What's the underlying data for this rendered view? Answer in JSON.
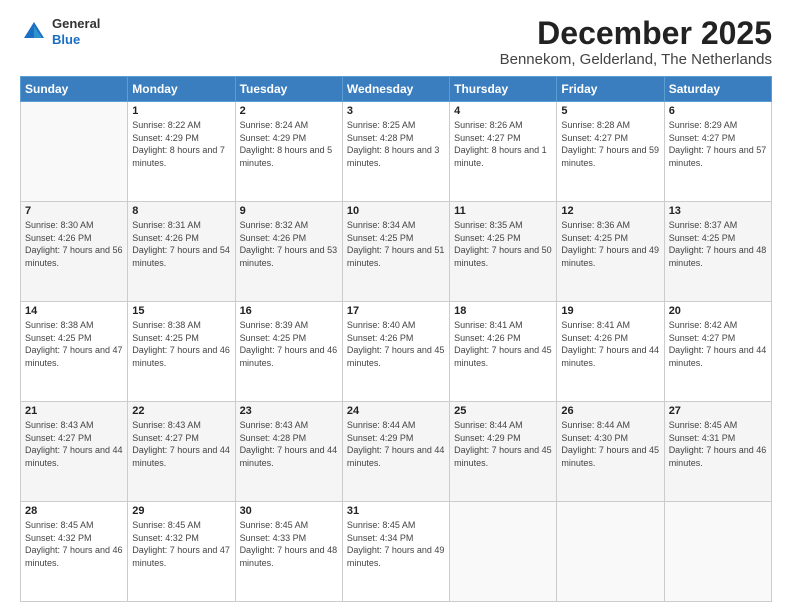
{
  "logo": {
    "general": "General",
    "blue": "Blue"
  },
  "header": {
    "month": "December 2025",
    "location": "Bennekom, Gelderland, The Netherlands"
  },
  "weekdays": [
    "Sunday",
    "Monday",
    "Tuesday",
    "Wednesday",
    "Thursday",
    "Friday",
    "Saturday"
  ],
  "weeks": [
    [
      {
        "day": "",
        "sunrise": "",
        "sunset": "",
        "daylight": ""
      },
      {
        "day": "1",
        "sunrise": "Sunrise: 8:22 AM",
        "sunset": "Sunset: 4:29 PM",
        "daylight": "Daylight: 8 hours and 7 minutes."
      },
      {
        "day": "2",
        "sunrise": "Sunrise: 8:24 AM",
        "sunset": "Sunset: 4:29 PM",
        "daylight": "Daylight: 8 hours and 5 minutes."
      },
      {
        "day": "3",
        "sunrise": "Sunrise: 8:25 AM",
        "sunset": "Sunset: 4:28 PM",
        "daylight": "Daylight: 8 hours and 3 minutes."
      },
      {
        "day": "4",
        "sunrise": "Sunrise: 8:26 AM",
        "sunset": "Sunset: 4:27 PM",
        "daylight": "Daylight: 8 hours and 1 minute."
      },
      {
        "day": "5",
        "sunrise": "Sunrise: 8:28 AM",
        "sunset": "Sunset: 4:27 PM",
        "daylight": "Daylight: 7 hours and 59 minutes."
      },
      {
        "day": "6",
        "sunrise": "Sunrise: 8:29 AM",
        "sunset": "Sunset: 4:27 PM",
        "daylight": "Daylight: 7 hours and 57 minutes."
      }
    ],
    [
      {
        "day": "7",
        "sunrise": "Sunrise: 8:30 AM",
        "sunset": "Sunset: 4:26 PM",
        "daylight": "Daylight: 7 hours and 56 minutes."
      },
      {
        "day": "8",
        "sunrise": "Sunrise: 8:31 AM",
        "sunset": "Sunset: 4:26 PM",
        "daylight": "Daylight: 7 hours and 54 minutes."
      },
      {
        "day": "9",
        "sunrise": "Sunrise: 8:32 AM",
        "sunset": "Sunset: 4:26 PM",
        "daylight": "Daylight: 7 hours and 53 minutes."
      },
      {
        "day": "10",
        "sunrise": "Sunrise: 8:34 AM",
        "sunset": "Sunset: 4:25 PM",
        "daylight": "Daylight: 7 hours and 51 minutes."
      },
      {
        "day": "11",
        "sunrise": "Sunrise: 8:35 AM",
        "sunset": "Sunset: 4:25 PM",
        "daylight": "Daylight: 7 hours and 50 minutes."
      },
      {
        "day": "12",
        "sunrise": "Sunrise: 8:36 AM",
        "sunset": "Sunset: 4:25 PM",
        "daylight": "Daylight: 7 hours and 49 minutes."
      },
      {
        "day": "13",
        "sunrise": "Sunrise: 8:37 AM",
        "sunset": "Sunset: 4:25 PM",
        "daylight": "Daylight: 7 hours and 48 minutes."
      }
    ],
    [
      {
        "day": "14",
        "sunrise": "Sunrise: 8:38 AM",
        "sunset": "Sunset: 4:25 PM",
        "daylight": "Daylight: 7 hours and 47 minutes."
      },
      {
        "day": "15",
        "sunrise": "Sunrise: 8:38 AM",
        "sunset": "Sunset: 4:25 PM",
        "daylight": "Daylight: 7 hours and 46 minutes."
      },
      {
        "day": "16",
        "sunrise": "Sunrise: 8:39 AM",
        "sunset": "Sunset: 4:25 PM",
        "daylight": "Daylight: 7 hours and 46 minutes."
      },
      {
        "day": "17",
        "sunrise": "Sunrise: 8:40 AM",
        "sunset": "Sunset: 4:26 PM",
        "daylight": "Daylight: 7 hours and 45 minutes."
      },
      {
        "day": "18",
        "sunrise": "Sunrise: 8:41 AM",
        "sunset": "Sunset: 4:26 PM",
        "daylight": "Daylight: 7 hours and 45 minutes."
      },
      {
        "day": "19",
        "sunrise": "Sunrise: 8:41 AM",
        "sunset": "Sunset: 4:26 PM",
        "daylight": "Daylight: 7 hours and 44 minutes."
      },
      {
        "day": "20",
        "sunrise": "Sunrise: 8:42 AM",
        "sunset": "Sunset: 4:27 PM",
        "daylight": "Daylight: 7 hours and 44 minutes."
      }
    ],
    [
      {
        "day": "21",
        "sunrise": "Sunrise: 8:43 AM",
        "sunset": "Sunset: 4:27 PM",
        "daylight": "Daylight: 7 hours and 44 minutes."
      },
      {
        "day": "22",
        "sunrise": "Sunrise: 8:43 AM",
        "sunset": "Sunset: 4:27 PM",
        "daylight": "Daylight: 7 hours and 44 minutes."
      },
      {
        "day": "23",
        "sunrise": "Sunrise: 8:43 AM",
        "sunset": "Sunset: 4:28 PM",
        "daylight": "Daylight: 7 hours and 44 minutes."
      },
      {
        "day": "24",
        "sunrise": "Sunrise: 8:44 AM",
        "sunset": "Sunset: 4:29 PM",
        "daylight": "Daylight: 7 hours and 44 minutes."
      },
      {
        "day": "25",
        "sunrise": "Sunrise: 8:44 AM",
        "sunset": "Sunset: 4:29 PM",
        "daylight": "Daylight: 7 hours and 45 minutes."
      },
      {
        "day": "26",
        "sunrise": "Sunrise: 8:44 AM",
        "sunset": "Sunset: 4:30 PM",
        "daylight": "Daylight: 7 hours and 45 minutes."
      },
      {
        "day": "27",
        "sunrise": "Sunrise: 8:45 AM",
        "sunset": "Sunset: 4:31 PM",
        "daylight": "Daylight: 7 hours and 46 minutes."
      }
    ],
    [
      {
        "day": "28",
        "sunrise": "Sunrise: 8:45 AM",
        "sunset": "Sunset: 4:32 PM",
        "daylight": "Daylight: 7 hours and 46 minutes."
      },
      {
        "day": "29",
        "sunrise": "Sunrise: 8:45 AM",
        "sunset": "Sunset: 4:32 PM",
        "daylight": "Daylight: 7 hours and 47 minutes."
      },
      {
        "day": "30",
        "sunrise": "Sunrise: 8:45 AM",
        "sunset": "Sunset: 4:33 PM",
        "daylight": "Daylight: 7 hours and 48 minutes."
      },
      {
        "day": "31",
        "sunrise": "Sunrise: 8:45 AM",
        "sunset": "Sunset: 4:34 PM",
        "daylight": "Daylight: 7 hours and 49 minutes."
      },
      {
        "day": "",
        "sunrise": "",
        "sunset": "",
        "daylight": ""
      },
      {
        "day": "",
        "sunrise": "",
        "sunset": "",
        "daylight": ""
      },
      {
        "day": "",
        "sunrise": "",
        "sunset": "",
        "daylight": ""
      }
    ]
  ]
}
